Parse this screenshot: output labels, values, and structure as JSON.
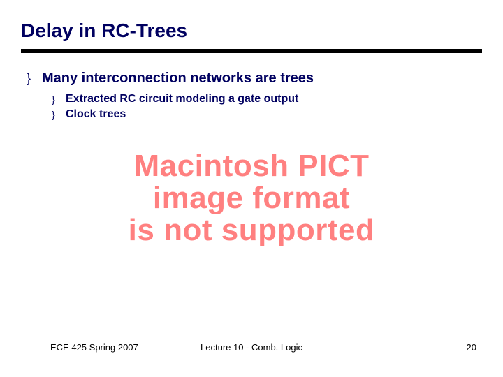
{
  "title": "Delay in RC-Trees",
  "bullet_glyph": "}",
  "main_bullet": "Many interconnection networks are trees",
  "sub_bullets": [
    "Extracted RC circuit modeling a gate output",
    "Clock trees"
  ],
  "pict_lines": [
    "Macintosh PICT",
    "image format",
    "is not supported"
  ],
  "footer": {
    "left": "ECE 425 Spring 2007",
    "center": "Lecture 10 - Comb. Logic",
    "right": "20"
  }
}
